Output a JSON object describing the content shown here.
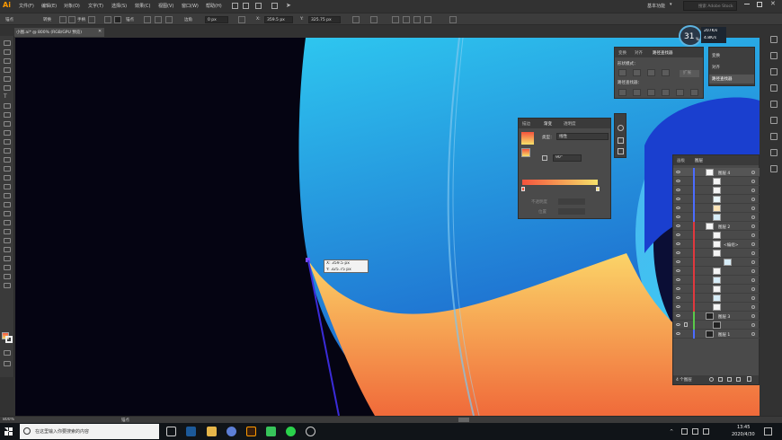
{
  "app": {
    "logo": "Ai",
    "menus": [
      "文件(F)",
      "编辑(E)",
      "对象(O)",
      "文字(T)",
      "选择(S)",
      "效果(C)",
      "视图(V)",
      "窗口(W)",
      "帮助(H)"
    ],
    "workspace": "基本功能",
    "search_placeholder": "搜索 Adobe Stock"
  },
  "controlbar": {
    "anchor_label": "锚点",
    "convert_label": "转换",
    "handles_label": "手柄",
    "anchor2_label": "锚点",
    "corner_label": "边角",
    "corner_value": "0 px",
    "x_value": "359.5 px",
    "y_value": "325.75 px",
    "w_value": "0 px"
  },
  "document": {
    "tab_title": "小图.ai* @ 800% (RGB/GPU 预览)"
  },
  "clock_badge": {
    "number": "31",
    "unit": "%",
    "up_rate": "207K/s",
    "down_rate": "4.8K/s"
  },
  "cursor_tooltip": {
    "x": "X: 359.5 px",
    "y": "Y: 325.75 px"
  },
  "pathfinder_panel": {
    "tabs": [
      "变换",
      "对齐",
      "路径查找器"
    ],
    "shape_modes_label": "形状模式：",
    "pathfinders_label": "路径查找器：",
    "expand_label": "扩展"
  },
  "flyout_menu": {
    "items": [
      "变换",
      "对齐",
      "路径查找器"
    ]
  },
  "gradient_panel": {
    "tabs": [
      "描边",
      "渐变",
      "透明度"
    ],
    "type_label": "类型：",
    "type_value": "线性",
    "angle_value": "90°",
    "opacity_label": "不透明度",
    "location_label": "位置",
    "start_color": "#f5533d",
    "end_color": "#f6e26a"
  },
  "layers_panel": {
    "tabs": [
      "画板",
      "图层"
    ],
    "layer_names": [
      "图层 4",
      "图层 2",
      "图层 3",
      "图层 1"
    ],
    "sublayer_label": "<路径>",
    "clip_label": "<编组>",
    "footer_count": "4 个图层",
    "layer_colors": [
      "#4b6cff",
      "#e0383e",
      "#59c94a",
      "#4b6cff"
    ]
  },
  "statusbar": {
    "zoom": "800%",
    "tool": "锚点"
  },
  "taskbar": {
    "search_placeholder": "在这里输入你要搜索的内容",
    "time": "13:45",
    "date": "2020/4/30"
  },
  "colors": {
    "sky_top": "#2ec6ef",
    "sky_bottom": "#1b5cc9",
    "orange_top": "#fbd468",
    "orange_bottom": "#f06a3a",
    "dark_bg": "#050412"
  }
}
